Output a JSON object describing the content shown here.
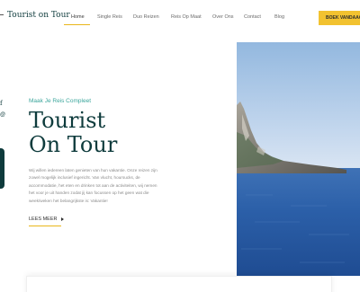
{
  "brand": {
    "logo_text": "Tourist on Tour"
  },
  "nav": {
    "items": [
      {
        "label": "Home",
        "active": true
      },
      {
        "label": "Single Reis",
        "active": false
      },
      {
        "label": "Duo Reizen",
        "active": false
      },
      {
        "label": "Reis Op Maat",
        "active": false
      },
      {
        "label": "Over Ons",
        "active": false
      },
      {
        "label": "Contact",
        "active": false
      },
      {
        "label": "Blog",
        "active": false
      }
    ],
    "cta_label": "BOEK VANDAAG"
  },
  "side": {
    "fragment_1": "f",
    "fragment_2": "@"
  },
  "hero": {
    "kicker": "Maak Je Reis Compleet",
    "title_line_1": "Tourist",
    "title_line_2": "On Tour",
    "description": "Wij willen iedereen laten genieten van hun vakantie. Onze reizen zijn zowel mogelijk inclusief ingericht. Van vlucht, hoursucks, de accommodatie, het eten en drinken tot aan de activiteiten, wij nemen het voor je uit handen zodat jij kan focussen op het geen wat die week/weken het belangrijkste is: Vakantie!",
    "more_label": "LEES MEER"
  },
  "colors": {
    "primary": "#0e3b3c",
    "accent": "#f2c230",
    "kicker": "#3aa59b",
    "sea": "#2b5fa8"
  },
  "icons": {
    "more_arrow": "play-arrow-icon"
  }
}
